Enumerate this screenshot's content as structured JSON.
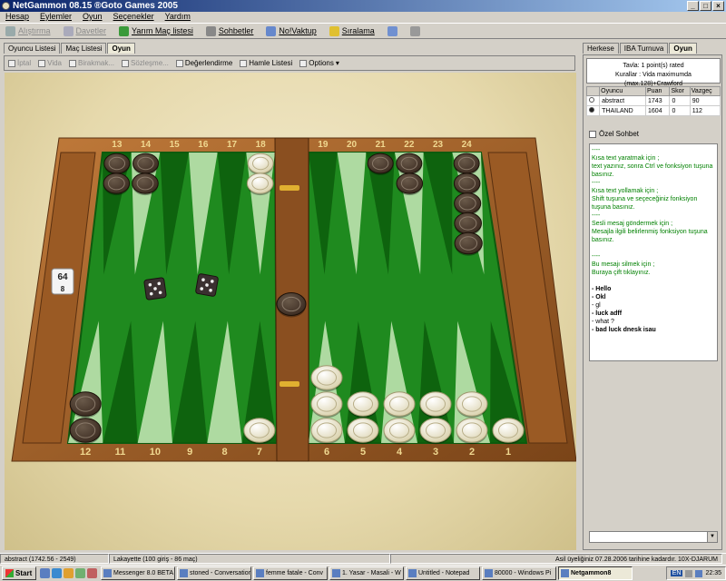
{
  "window": {
    "title": "NetGammon 08.15 ®Goto Games 2005"
  },
  "menu": [
    "Hesap",
    "Eylemler",
    "Oyun",
    "Seçenekler",
    "Yardım"
  ],
  "toolbar": [
    {
      "label": "Alıştırma",
      "enabled": false,
      "icon": "practice-icon",
      "color": "#9aa"
    },
    {
      "label": "Davetler",
      "enabled": false,
      "icon": "invites-icon",
      "color": "#aab"
    },
    {
      "label": "Yarım Maç listesi",
      "enabled": true,
      "icon": "half-match-icon",
      "color": "#3a9a3a"
    },
    {
      "label": "Sohbetler",
      "enabled": true,
      "icon": "chat-icon",
      "color": "#888"
    },
    {
      "label": "No!Vaktup",
      "enabled": true,
      "icon": "notebook-icon",
      "color": "#6688cc"
    },
    {
      "label": "Sıralama",
      "enabled": true,
      "icon": "ranking-icon",
      "color": "#e0c030"
    },
    {
      "label": "",
      "enabled": true,
      "icon": "help-icon",
      "color": "#7090d0"
    },
    {
      "label": "",
      "enabled": false,
      "icon": "flag-icon",
      "color": "#999"
    }
  ],
  "left_tabs": [
    {
      "label": "Oyuncu Listesi",
      "active": false
    },
    {
      "label": "Maç Listesi",
      "active": false
    },
    {
      "label": "Oyun",
      "active": true
    }
  ],
  "game_toolbar": [
    {
      "label": "İptal",
      "enabled": false
    },
    {
      "label": "Vida",
      "enabled": false
    },
    {
      "label": "Birakmak...",
      "enabled": false
    },
    {
      "label": "Sözleşme...",
      "enabled": false
    },
    {
      "label": "Değerlendirme",
      "enabled": true
    },
    {
      "label": "Hamle Listesi",
      "enabled": true
    },
    {
      "label": "Options",
      "enabled": true,
      "dropdown": true
    }
  ],
  "board": {
    "top_numbers": [
      "13",
      "14",
      "15",
      "16",
      "17",
      "18",
      "19",
      "20",
      "21",
      "22",
      "23",
      "24"
    ],
    "bottom_numbers": [
      "12",
      "11",
      "10",
      "9",
      "8",
      "7",
      "6",
      "5",
      "4",
      "3",
      "2",
      "1"
    ],
    "doubling_cube": {
      "value": "64",
      "sub": "8"
    },
    "dice": [
      5,
      5
    ],
    "colors": {
      "felt": "#1f8a1f",
      "felt_dark": "#0e5a0e",
      "triangle_light": "#c8e8b8",
      "triangle_dark": "#0c5c0c",
      "wood": "#a0602a",
      "dark_checker": "#3a2a20",
      "light_checker": "#f2ecd0"
    },
    "checkers": {
      "top": [
        {
          "point": 13,
          "dark": 2,
          "light": 0
        },
        {
          "point": 14,
          "dark": 2,
          "light": 0
        },
        {
          "point": 18,
          "dark": 0,
          "light": 2
        },
        {
          "point": 21,
          "dark": 1,
          "light": 0
        },
        {
          "point": 22,
          "dark": 2,
          "light": 0
        },
        {
          "point": 24,
          "dark": 5,
          "light": 0
        }
      ],
      "bottom": [
        {
          "point": 12,
          "dark": 2,
          "light": 0
        },
        {
          "point": 7,
          "dark": 0,
          "light": 1
        },
        {
          "point": 6,
          "dark": 0,
          "light": 3
        },
        {
          "point": 5,
          "dark": 0,
          "light": 2
        },
        {
          "point": 4,
          "dark": 0,
          "light": 2
        },
        {
          "point": 3,
          "dark": 0,
          "light": 2
        },
        {
          "point": 2,
          "dark": 0,
          "light": 2
        },
        {
          "point": 1,
          "dark": 0,
          "light": 1
        }
      ],
      "bar_dark": 1
    }
  },
  "right_tabs": [
    {
      "label": "Herkese",
      "active": false
    },
    {
      "label": "IBA Turnuva",
      "active": false
    },
    {
      "label": "Oyun",
      "active": true
    }
  ],
  "match_info": {
    "line1": "Tavla: 1 point(s) rated",
    "line2": "Kurallar : Vida maximumda (max.128)+Crawford"
  },
  "player_table": {
    "headers": [
      "",
      "Oyuncu",
      "Puan",
      "Skor",
      "Vazgeç"
    ],
    "rows": [
      {
        "name": "abstract",
        "rating": "1743",
        "score": "0",
        "pips": "90",
        "dark": false
      },
      {
        "name": "THAILAND",
        "rating": "1604",
        "score": "0",
        "pips": "112",
        "dark": true
      }
    ]
  },
  "private_chat_label": "Özel Sohbet",
  "chat": [
    {
      "t": "sys",
      "text": "----"
    },
    {
      "t": "sys",
      "text": "Kısa text yaratmak için ;"
    },
    {
      "t": "sys",
      "text": "text yazınız, sonra Ctrl ve fonksiyon tuşuna basınız."
    },
    {
      "t": "sys",
      "text": "----"
    },
    {
      "t": "sys",
      "text": "Kısa text yollamak için ;"
    },
    {
      "t": "sys",
      "text": "Shift tuşuna ve seçeceğiniz fonksiyon tuşuna basınız."
    },
    {
      "t": "sys",
      "text": "----"
    },
    {
      "t": "sys",
      "text": "Sesli mesaj göndermek için ;"
    },
    {
      "t": "sys",
      "text": "Mesajla ilgili belirlenmiş fonksiyon tuşuna basınız."
    },
    {
      "t": "gap",
      "text": ""
    },
    {
      "t": "sys",
      "text": "----"
    },
    {
      "t": "sys",
      "text": "Bu mesajı silmek için ;"
    },
    {
      "t": "sys",
      "text": "Buraya çift tıklayınız."
    },
    {
      "t": "gap",
      "text": ""
    },
    {
      "t": "msg",
      "text": "- Hello"
    },
    {
      "t": "msg",
      "text": "- Okl"
    },
    {
      "t": "plain",
      "text": "- gl"
    },
    {
      "t": "msg",
      "text": "- luck adff"
    },
    {
      "t": "plain",
      "text": "- what ?"
    },
    {
      "t": "msg",
      "text": "- bad luck dnesk isau"
    }
  ],
  "status": [
    "abstract (1742.56 - 2549)",
    "Lakayette (100 giriş - 86 maç)",
    "Asil üyeliğiniz 07.28.2006 tarihine kadardır. 10X-DJARUM"
  ],
  "taskbar": {
    "start": "Start",
    "tasks": [
      {
        "label": "Messenger 8.0 BETA",
        "active": false
      },
      {
        "label": "stoned - Conversation",
        "active": false
      },
      {
        "label": "femme fatale - Conv",
        "active": false
      },
      {
        "label": "1. Yasar - Masali - W",
        "active": false
      },
      {
        "label": "Untitled - Notepad",
        "active": false
      },
      {
        "label": "80000 - Windows Pi",
        "active": false
      },
      {
        "label": "Netgammon8",
        "active": true
      }
    ],
    "tray_lang": "EN",
    "clock": "22:35"
  }
}
